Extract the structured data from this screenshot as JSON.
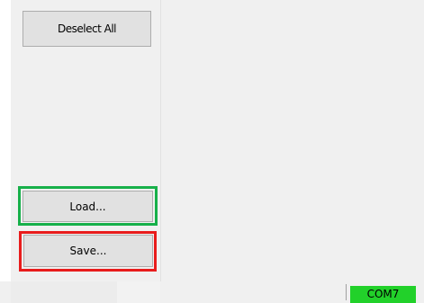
{
  "left_panel": {
    "deselect_all_label": "Deselect All",
    "load_label": "Load...",
    "save_label": "Save..."
  },
  "highlights": {
    "load_color": "#17b04a",
    "save_color": "#e81c1c"
  },
  "status_bar": {
    "com_port": "COM7",
    "com_port_color": "#22d12a"
  }
}
